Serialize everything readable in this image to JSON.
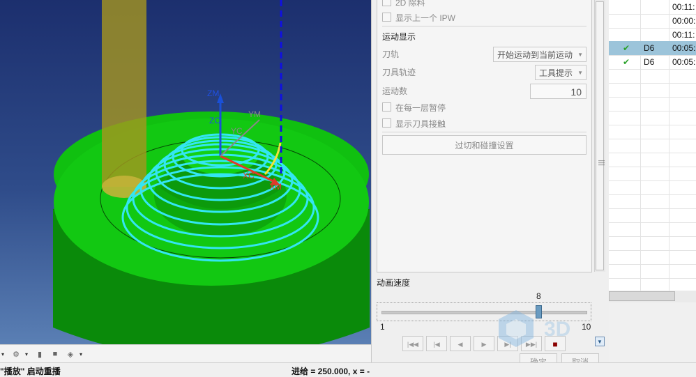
{
  "viewport": {
    "axis_labels": [
      "ZM",
      "ZC",
      "YM",
      "YC",
      "XC",
      "XM"
    ]
  },
  "toolbar": {
    "icons": [
      "tool-icon",
      "dropdown-icon",
      "cube-icon",
      "dropdown-icon"
    ]
  },
  "statusbar": {
    "left_text": "\"播放\" 启动重播",
    "right_text": "进给 = 250.000, x = -"
  },
  "dialog": {
    "row_2d": "2D 除料",
    "row_prev_ipw": "显示上一个 IPW",
    "motion_display_title": "运动显示",
    "toolpath_label": "刀轨",
    "toolpath_value": "开始运动到当前运动",
    "tool_trace_label": "刀具轨迹",
    "tool_trace_value": "工具提示",
    "motion_count_label": "运动数",
    "motion_count_value": "10",
    "pause_each_layer": "在每一层暂停",
    "show_tool_contact": "显示刀具接触",
    "overcut_button": "过切和碰撞设置",
    "speed_label": "动画速度",
    "speed_value": "8",
    "speed_min": "1",
    "speed_max": "10",
    "ok_button": "确定",
    "cancel_button": "取消"
  },
  "table": {
    "rows": [
      {
        "tool": "",
        "time": "00:11:"
      },
      {
        "tool": "",
        "time": "00:00:"
      },
      {
        "tool": "",
        "time": "00:11:"
      },
      {
        "tool": "D6",
        "time": "00:05:",
        "check": "✔",
        "selected": true
      },
      {
        "tool": "D6",
        "time": "00:05:",
        "check": "✔",
        "selected": false
      }
    ]
  },
  "watermark": {
    "text": "3D"
  },
  "colors": {
    "part_green": "#12c812",
    "toolpath_cyan": "#33e6f2",
    "selection_blue": "#9cc4da"
  }
}
